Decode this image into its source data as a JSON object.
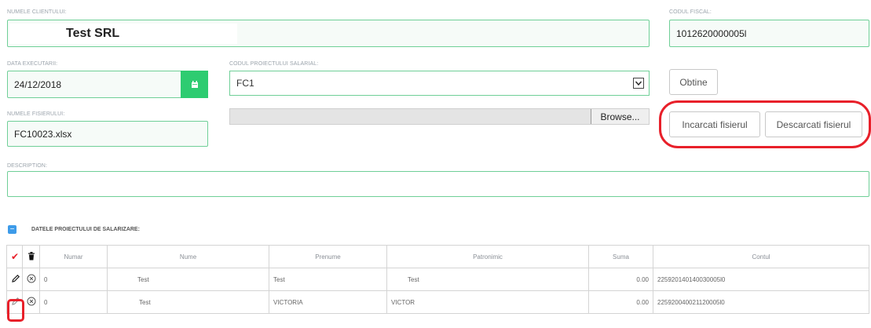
{
  "form": {
    "client_label": "NUMELE CLIENTULUI:",
    "client_value": "Test SRL",
    "fiscal_label": "CODUL FISCAL:",
    "fiscal_value": "1012620000005l",
    "date_label": "DATA EXECUTARII:",
    "date_value": "24/12/2018",
    "project_label": "CODUL PROIECTULUI SALARIAL:",
    "project_value": "FC1",
    "obtine_label": "Obtine",
    "file_label": "NUMELE FISIERULUI:",
    "file_value": "FC10023.xlsx",
    "browse_label": "Browse...",
    "upload_label": "Incarcati fisierul",
    "download_label": "Descarcati fisierul",
    "description_label": "DESCRIPTION:",
    "description_value": ""
  },
  "section": {
    "collapse_symbol": "−",
    "title": "DATELE PROIECTULUI DE SALARIZARE:"
  },
  "table": {
    "headers": [
      "Numar",
      "Nume",
      "Prenume",
      "Patronimic",
      "Suma",
      "Contul"
    ],
    "check_symbol": "✔",
    "rows": [
      {
        "numar": "0",
        "nume": "Test",
        "prenume": "Test",
        "patronimic": "Test",
        "suma": "0.00",
        "contul": "225920140140030005l0"
      },
      {
        "numar": "0",
        "nume": "Test",
        "prenume": "VICTORIA",
        "patronimic": "VICTOR",
        "suma": "0.00",
        "contul": "225920040021120005l0"
      }
    ]
  },
  "colors": {
    "accent_green": "#2ecc71",
    "field_border": "#6fcf97",
    "highlight_red": "#e8202a",
    "section_blue": "#3d9be9"
  }
}
